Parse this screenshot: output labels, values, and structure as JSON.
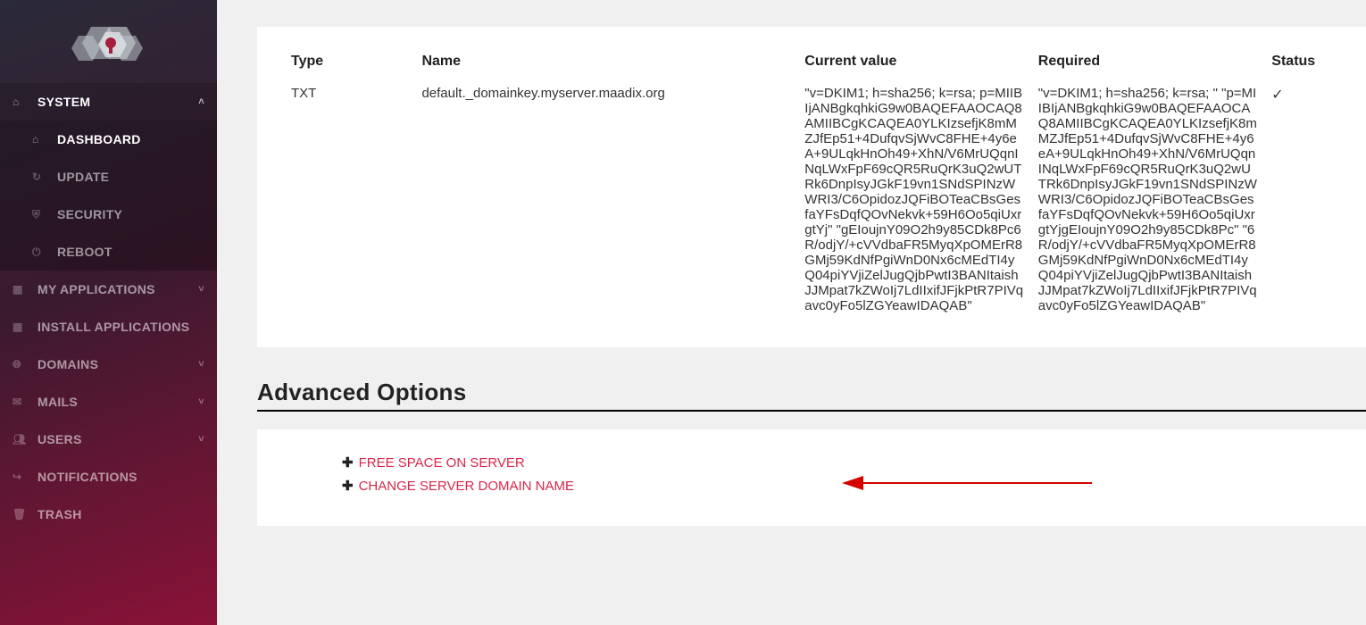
{
  "sidebar": {
    "system": "SYSTEM",
    "dashboard": "DASHBOARD",
    "update": "UPDATE",
    "security": "SECURITY",
    "reboot": "REBOOT",
    "myapps": "MY APPLICATIONS",
    "installapps": "INSTALL APPLICATIONS",
    "domains": "DOMAINS",
    "mails": "MAILS",
    "users": "USERS",
    "notifications": "NOTIFICATIONS",
    "trash": "TRASH"
  },
  "table": {
    "headers": {
      "type": "Type",
      "name": "Name",
      "current": "Current value",
      "required": "Required",
      "status": "Status"
    },
    "row": {
      "type": "TXT",
      "name": "default._domainkey.myserver.maadix.org",
      "current": "\"v=DKIM1; h=sha256; k=rsa;  p=MIIBIjANBgkqhkiG9w0BAQEFAAOCAQ8AMIIBCgKCAQEA0YLKIzsefjK8mMZJfEp51+4DufqvSjWvC8FHE+4y6eA+9ULqkHnOh49+XhN/V6MrUQqnINqLWxFpF69cQR5RuQrK3uQ2wUTRk6DnpIsyJGkF19vn1SNdSPINzWWRI3/C6OpidozJQFiBOTeaCBsGesfaYFsDqfQOvNekvk+59H6Oo5qiUxrgtYj\" \"gEIoujnY09O2h9y85CDk8Pc6R/odjY/+cVVdbaFR5MyqXpOMErR8GMj59KdNfPgiWnD0Nx6cMEdTI4yQ04piYVjiZelJugQjbPwtI3BANItaishJJMpat7kZWoIj7LdIIxifJFjkPtR7PIVqavc0yFo5lZGYeawIDAQAB\"",
      "required": "\"v=DKIM1; h=sha256; k=rsa; \" \"p=MIIBIjANBgkqhkiG9w0BAQEFAAOCAQ8AMIIBCgKCAQEA0YLKIzsefjK8mMZJfEp51+4DufqvSjWvC8FHE+4y6eA+9ULqkHnOh49+XhN/V6MrUQqnINqLWxFpF69cQR5RuQrK3uQ2wUTRk6DnpIsyJGkF19vn1SNdSPINzWWRI3/C6OpidozJQFiBOTeaCBsGesfaYFsDqfQOvNekvk+59H6Oo5qiUxrgtYjgEIoujnY09O2h9y85CDk8Pc\" \"6R/odjY/+cVVdbaFR5MyqXpOMErR8GMj59KdNfPgiWnD0Nx6cMEdTI4yQ04piYVjiZelJugQjbPwtI3BANItaishJJMpat7kZWoIj7LdIIxifJFjkPtR7PIVqavc0yFo5lZGYeawIDAQAB\"",
      "status": "✓"
    }
  },
  "advanced": {
    "title": "Advanced Options",
    "free_space": "FREE SPACE ON SERVER",
    "change_domain": "CHANGE SERVER DOMAIN NAME"
  }
}
